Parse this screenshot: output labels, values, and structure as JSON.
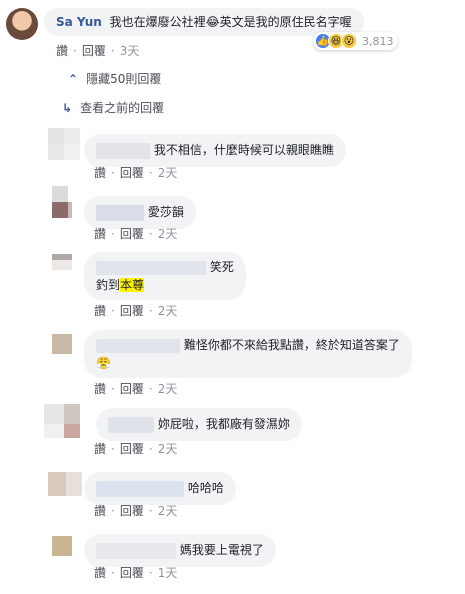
{
  "top_comment": {
    "author": "Sa Yun",
    "text": "我也在爆廢公社裡😂英文是我的原住民名字喔",
    "actions": {
      "like": "讚",
      "reply": "回覆",
      "time": "3天"
    },
    "reactions": {
      "count": "3,813",
      "icons": [
        "like-icon",
        "haha-icon",
        "wow-icon"
      ]
    }
  },
  "thread": {
    "hide_replies": "隱藏50則回覆",
    "view_previous": "查看之前的回覆"
  },
  "replies": [
    {
      "text": "我不相信，什麼時候可以親眼瞧瞧",
      "actions": {
        "like": "讚",
        "reply": "回覆",
        "time": "2天"
      }
    },
    {
      "text": "愛莎韻",
      "actions": {
        "like": "讚",
        "reply": "回覆",
        "time": "2天"
      }
    },
    {
      "text_line1": "笑死",
      "text_line2_prefix": "釣到",
      "text_line2_highlight": "本尊",
      "actions": {
        "like": "讚",
        "reply": "回覆",
        "time": "2天"
      }
    },
    {
      "text_line1": "難怪你都不來給我點讚，終於知道答案了",
      "emoji": "😤",
      "actions": {
        "like": "讚",
        "reply": "回覆",
        "time": "2天"
      }
    },
    {
      "text": "妳屁啦，我都廠有發濕妳",
      "actions": {
        "like": "讚",
        "reply": "回覆",
        "time": "2天"
      }
    },
    {
      "text": "哈哈哈",
      "actions": {
        "like": "讚",
        "reply": "回覆",
        "time": "2天"
      }
    },
    {
      "text": "媽我要上電視了",
      "actions": {
        "like": "讚",
        "reply": "回覆",
        "time": "1天"
      }
    }
  ],
  "colors": {
    "link": "#385898",
    "bubble": "#f2f3f5",
    "meta": "#90949c",
    "highlight": "#fff200"
  }
}
